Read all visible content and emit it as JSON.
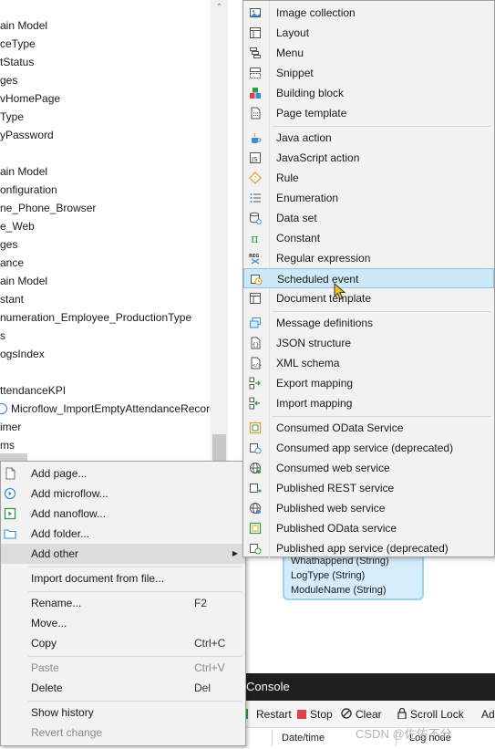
{
  "tree": {
    "rows": [
      "ain Model",
      "ceType",
      "tStatus",
      "ges",
      "vHomePage",
      "Type",
      "yPassword",
      "",
      "ain Model",
      "onfiguration",
      "ne_Phone_Browser",
      "e_Web",
      "ges",
      "ance",
      "ain Model",
      "stant",
      "numeration_Employee_ProductionType",
      "s",
      "ogsIndex",
      "",
      "ttendanceKPI",
      "Microflow_ImportEmptyAttendanceRecord",
      "imer",
      "ms"
    ],
    "scroll_up_glyph": "⌃"
  },
  "context_menu": {
    "add_page": "Add page...",
    "add_microflow": "Add microflow...",
    "add_nanoflow": "Add nanoflow...",
    "add_folder": "Add folder...",
    "add_other": "Add other",
    "add_other_arrow": "▶",
    "import_document": "Import document from file...",
    "rename": "Rename...",
    "rename_shortcut": "F2",
    "move": "Move...",
    "copy": "Copy",
    "copy_shortcut": "Ctrl+C",
    "paste": "Paste",
    "paste_shortcut": "Ctrl+V",
    "delete": "Delete",
    "delete_shortcut": "Del",
    "show_history": "Show history",
    "revert_change": "Revert change"
  },
  "submenu": {
    "image_collection": "Image collection",
    "layout": "Layout",
    "menu": "Menu",
    "snippet": "Snippet",
    "building_block": "Building block",
    "page_template": "Page template",
    "java_action": "Java action",
    "javascript_action": "JavaScript action",
    "rule": "Rule",
    "enumeration": "Enumeration",
    "data_set": "Data set",
    "constant": "Constant",
    "regular_expression": "Regular expression",
    "scheduled_event": "Scheduled event",
    "document_template": "Document template",
    "message_definitions": "Message definitions",
    "json_structure": "JSON structure",
    "xml_schema": "XML schema",
    "export_mapping": "Export mapping",
    "import_mapping": "Import mapping",
    "consumed_odata_service": "Consumed OData Service",
    "consumed_app_service": "Consumed app service (deprecated)",
    "consumed_web_service": "Consumed web service",
    "published_rest_service": "Published REST service",
    "published_web_service": "Published web service",
    "published_odata_service": "Published OData service",
    "published_app_service": "Published app service (deprecated)"
  },
  "entity": {
    "attr1": "Whathappend (String)",
    "attr2": "LogType (String)",
    "attr3": "ModuleName (String)"
  },
  "console": {
    "title": "Console",
    "restart": "Restart",
    "stop": "Stop",
    "clear": "Clear",
    "scroll_lock": "Scroll Lock",
    "more": "Ad",
    "col_datetime": "Date/time",
    "col_lognode": "Log node"
  },
  "watermark": "CSDN @佐佑不分",
  "colors": {
    "highlight_bg": "#cde8f7",
    "highlight_border": "#8fc2e6",
    "console_bar": "#1f1f1f",
    "entity_fill": "#d4ecfb"
  }
}
